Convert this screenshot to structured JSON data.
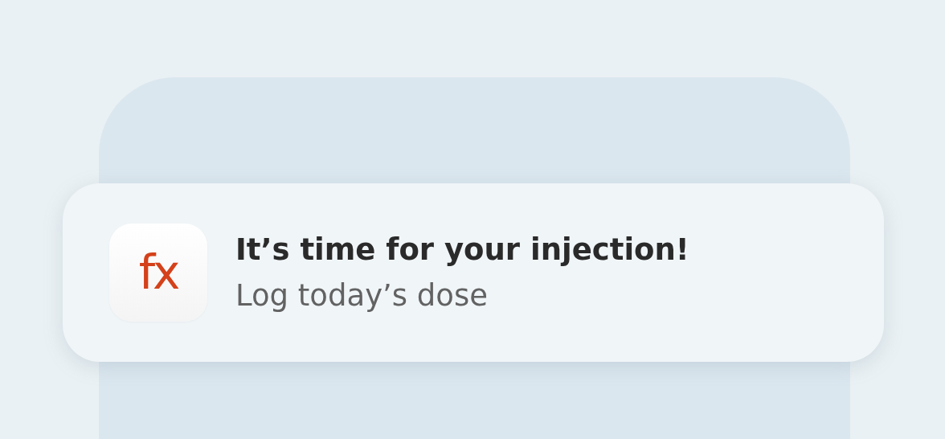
{
  "notification": {
    "app_icon": {
      "label": "fx"
    },
    "title": "It’s time for your injection!",
    "body": "Log today’s dose"
  }
}
